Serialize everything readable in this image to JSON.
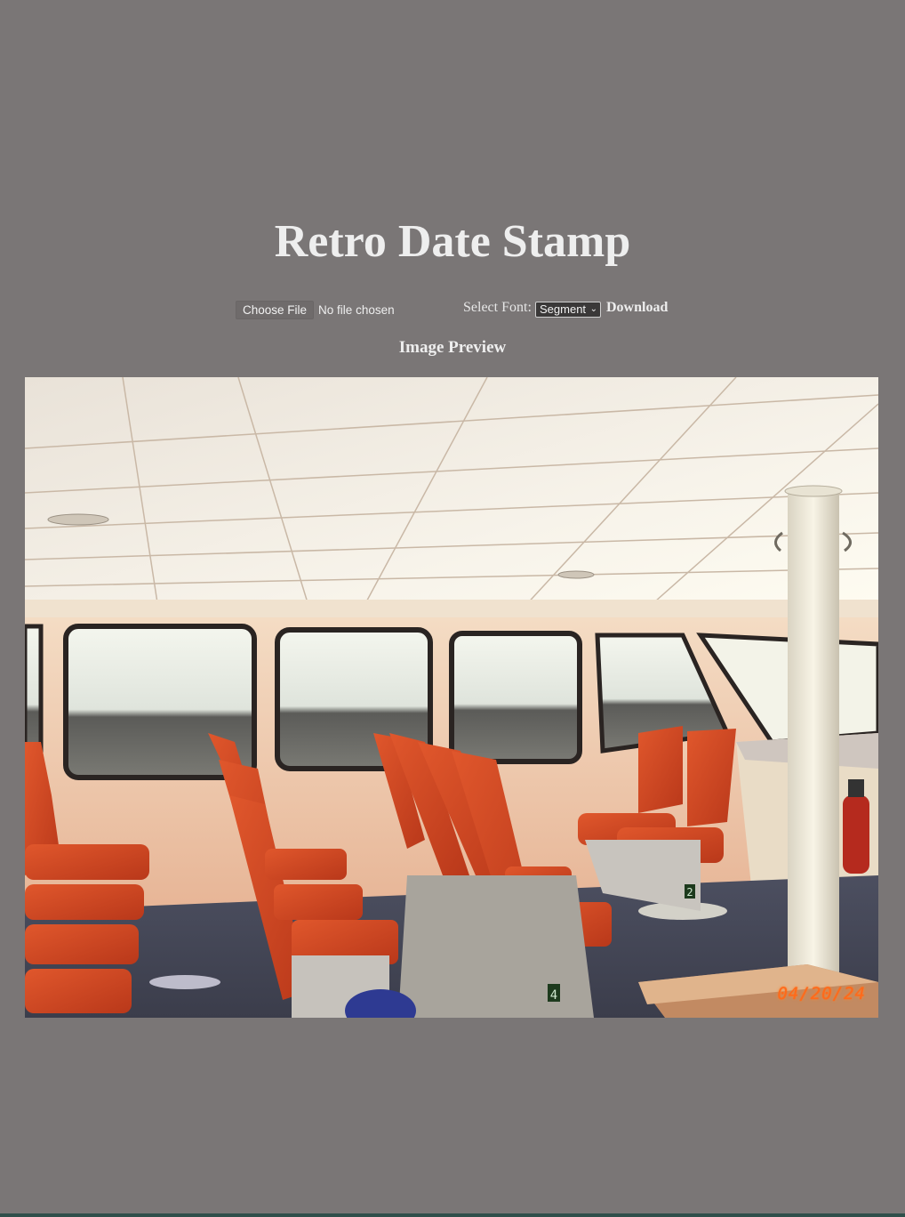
{
  "page": {
    "title": "Retro Date Stamp"
  },
  "controls": {
    "choose_file_label": "Choose File",
    "file_status": "No file chosen",
    "font_label": "Select Font:",
    "font_selected": "Segment",
    "download_label": "Download"
  },
  "preview": {
    "heading": "Image Preview",
    "date_stamp": "04/20/24",
    "stamp_color": "#ff6a1a",
    "seat_markers": [
      "4",
      "2"
    ]
  },
  "colors": {
    "background": "#7a7676",
    "text": "#eeeeee"
  }
}
